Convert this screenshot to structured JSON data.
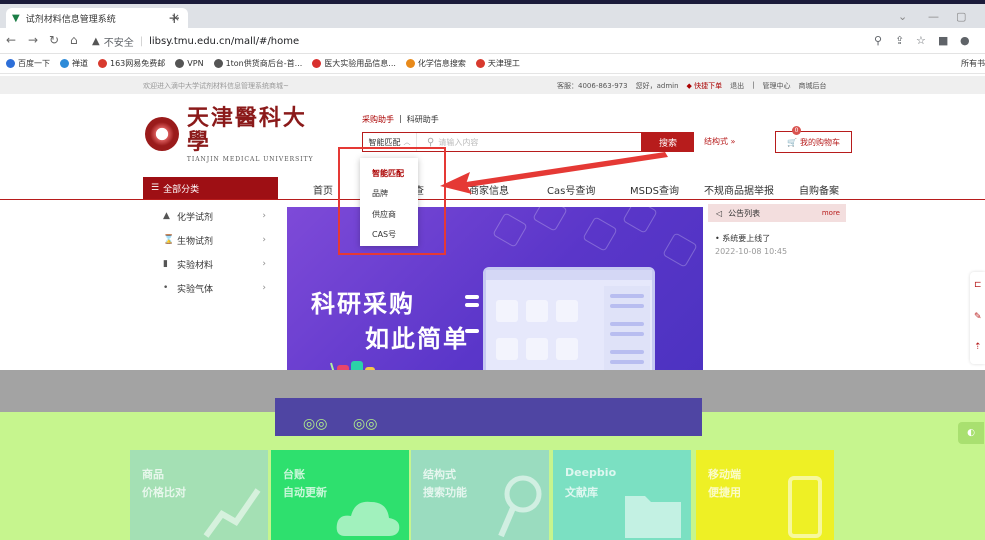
{
  "browser": {
    "tab_title": "试剂材料信息管理系统",
    "new_tab": "+",
    "close": "×",
    "insecure_label": "不安全",
    "url": "libsy.tmu.edu.cn/mall/#/home",
    "bookmarks": [
      {
        "label": "百度一下",
        "color": "#2e6fd8"
      },
      {
        "label": "禅道",
        "color": "#2e8bd8"
      },
      {
        "label": "163网易免费邮",
        "color": "#d83a2e"
      },
      {
        "label": "VPN",
        "color": "#555555"
      },
      {
        "label": "1ton供货商后台-首...",
        "color": "#555555"
      },
      {
        "label": "医大实验用品信息...",
        "color": "#d8302e"
      },
      {
        "label": "化学信息搜索",
        "color": "#e88a1a"
      },
      {
        "label": "天津理工",
        "color": "#d83a2e"
      }
    ],
    "all_bookmarks": "所有书"
  },
  "site": {
    "welcome": "欢迎进入滴中大学试剂材料信息管理系统商城~",
    "hotline": "客服：4006-863-973",
    "greeting": "您好，admin",
    "quick_order": "快捷下单",
    "logout": "退出",
    "manage_center": "管理中心",
    "mall_backend": "商城后台"
  },
  "header": {
    "logo_cn": "天津醫科大學",
    "logo_en": "TIANJIN MEDICAL UNIVERSITY",
    "assist_tabs": [
      "采购助手",
      "|",
      "科研助手"
    ],
    "search_mode": "智能匹配",
    "search_placeholder": "请输入内容",
    "search_button": "搜索",
    "struct_link": "结构式 »",
    "cart_label": "我的购物车",
    "cart_count": "0"
  },
  "nav": {
    "all_categories": "全部分类",
    "items": [
      "首页",
      "查",
      "商家信息",
      "Cas号查询",
      "MSDS查询",
      "不规商品据举报",
      "自购备案"
    ]
  },
  "categories": [
    {
      "label": "化学试剂",
      "icon": "flask-icon"
    },
    {
      "label": "生物试剂",
      "icon": "hourglass-icon"
    },
    {
      "label": "实验材料",
      "icon": "tube-icon"
    },
    {
      "label": "实验气体",
      "icon": "gas-icon"
    }
  ],
  "dropdown": {
    "options": [
      "智能匹配",
      "品牌",
      "供应商",
      "CAS号"
    ],
    "active_index": 0
  },
  "banner": {
    "line1": "科研采购",
    "line2": "如此简单"
  },
  "announcements": {
    "title": "公告列表",
    "more": "more",
    "items": [
      {
        "text": "• 系统要上线了",
        "date": "2022-10-08 10:45"
      }
    ]
  },
  "features": [
    {
      "line1": "商品",
      "line2": "价格比对",
      "color": "#a4e0b4"
    },
    {
      "line1": "台账",
      "line2": "自动更新",
      "color": "#2ee06e"
    },
    {
      "line1": "结构式",
      "line2": "搜索功能",
      "color": "#9adcbf"
    },
    {
      "line1": "Deepbio",
      "line2": "文献库",
      "color": "#7be0c2"
    },
    {
      "line1": "移动端",
      "line2": "便捷用",
      "color": "#eef025"
    }
  ],
  "colors": {
    "brand_red": "#b71c1c",
    "category_bar": "#9e0f14",
    "banner_purple": "#5a36c9",
    "overlay_green": "#c6f58e",
    "highlight_frame": "#e53935"
  }
}
